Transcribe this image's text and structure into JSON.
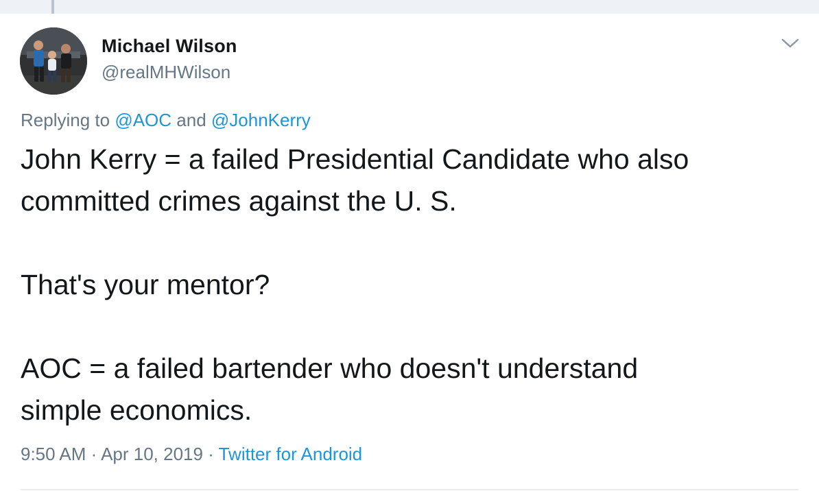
{
  "tweet": {
    "author": {
      "name": "Michael Wilson",
      "handle": "@realMHWilson",
      "avatar_icon": "profile-photo"
    },
    "reply": {
      "prefix": "Replying to ",
      "mentions": [
        "@AOC",
        "@JohnKerry"
      ],
      "conjunction": " and "
    },
    "text_lines": [
      "John Kerry = a failed Presidential Candidate who also",
      "committed crimes against the U. S.",
      "",
      "That's your mentor?",
      "",
      "AOC = a failed bartender who doesn't understand",
      "simple economics."
    ],
    "meta": {
      "time": "9:50 AM",
      "separator": " · ",
      "date": "Apr 10, 2019",
      "source": "Twitter for Android"
    },
    "menu_icon": "chevron-down-icon"
  },
  "colors": {
    "text": "#14171a",
    "secondary": "#657786",
    "link": "#1b95e0",
    "divider": "#e6ecf0",
    "thread_line": "#b8c4cf"
  }
}
